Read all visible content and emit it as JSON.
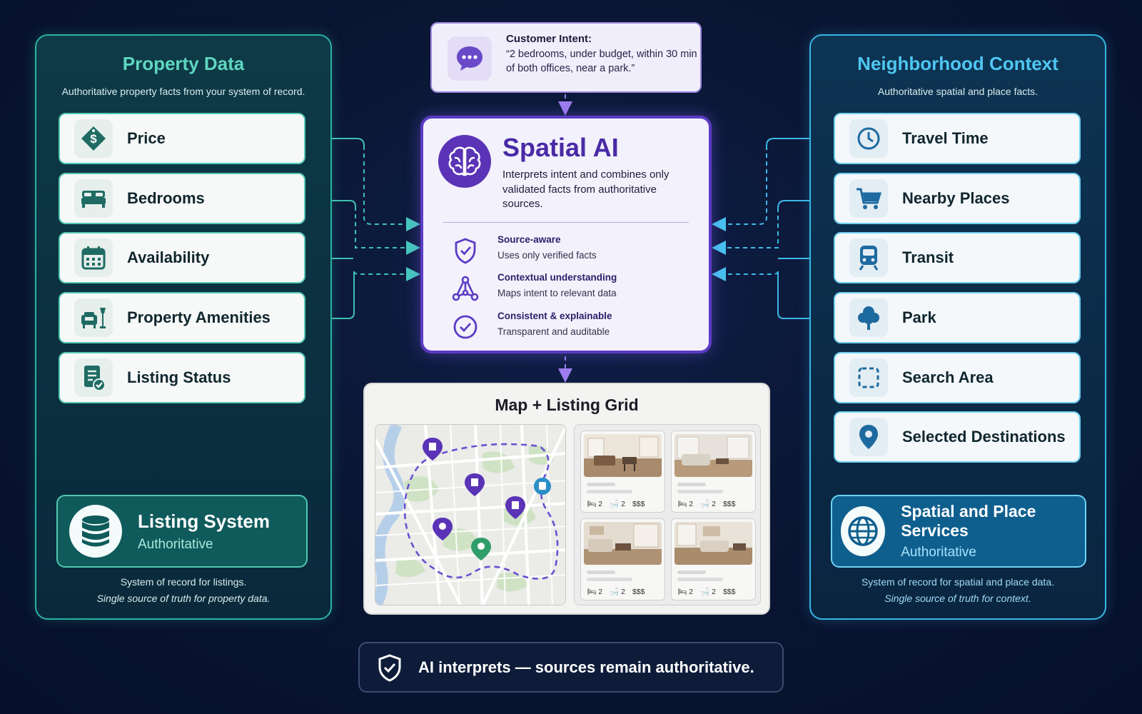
{
  "left_panel": {
    "title": "Property Data",
    "subtitle": "Authoritative property facts from your system of record.",
    "items": [
      {
        "label": "Price",
        "icon": "price-tag-icon"
      },
      {
        "label": "Bedrooms",
        "icon": "bed-icon"
      },
      {
        "label": "Availability",
        "icon": "calendar-icon"
      },
      {
        "label": "Property Amenities",
        "icon": "armchair-lamp-icon"
      },
      {
        "label": "Listing Status",
        "icon": "document-check-icon"
      }
    ],
    "source": {
      "name": "Listing System",
      "status": "Authoritative",
      "icon": "database-icon"
    },
    "footer": [
      "System of record for listings.",
      "Single source of truth for property data."
    ]
  },
  "right_panel": {
    "title": "Neighborhood Context",
    "subtitle": "Authoritative spatial and place facts.",
    "items": [
      {
        "label": "Travel Time",
        "icon": "clock-icon"
      },
      {
        "label": "Nearby Places",
        "icon": "shopping-cart-icon"
      },
      {
        "label": "Transit",
        "icon": "train-icon"
      },
      {
        "label": "Park",
        "icon": "tree-icon"
      },
      {
        "label": "Search Area",
        "icon": "dashed-square-icon"
      },
      {
        "label": "Selected Destinations",
        "icon": "location-pin-icon"
      }
    ],
    "source": {
      "name": "Spatial and Place Services",
      "status": "Authoritative",
      "icon": "globe-icon"
    },
    "footer": [
      "System of record for spatial and place data.",
      "Single source of truth for context."
    ]
  },
  "intent": {
    "title": "Customer Intent:",
    "quote": "“2 bedrooms, under budget, within 30 min of both offices, near a park.”",
    "icon": "chat-bubble-icon"
  },
  "spatial_ai": {
    "title": "Spatial AI",
    "description": "Interprets intent and combines only validated facts from authoritative sources.",
    "icon": "brain-icon",
    "features": [
      {
        "title": "Source-aware",
        "desc": "Uses only verified facts",
        "icon": "shield-check-icon"
      },
      {
        "title": "Contextual understanding",
        "desc": "Maps intent to relevant data",
        "icon": "network-nodes-icon"
      },
      {
        "title": "Consistent & explainable",
        "desc": "Transparent and auditable",
        "icon": "check-circle-icon"
      }
    ]
  },
  "map_grid": {
    "title": "Map + Listing Grid",
    "listings": [
      {
        "beds": "2",
        "baths": "2",
        "price": "$$$"
      },
      {
        "beds": "2",
        "baths": "2",
        "price": "$$$"
      },
      {
        "beds": "2",
        "baths": "2",
        "price": "$$$"
      },
      {
        "beds": "2",
        "baths": "2",
        "price": "$$$"
      }
    ]
  },
  "banner": {
    "text": "AI interprets — sources remain authoritative.",
    "icon": "shield-check-icon"
  },
  "colors": {
    "background": "#0a1633",
    "property_accent": "#2bb3a3",
    "context_accent": "#37b7e6",
    "ai_accent": "#5b3bc4",
    "intent_accent": "#9b87dc"
  }
}
